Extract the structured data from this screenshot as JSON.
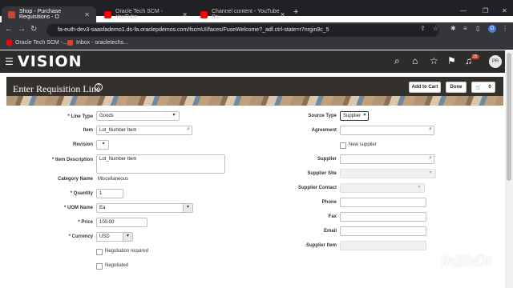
{
  "browser": {
    "tabs": [
      {
        "label": "Shop - Purchase Requisitions - O",
        "active": true
      },
      {
        "label": "Oracle Tech SCM - YouTube",
        "active": false
      },
      {
        "label": "Channel content - YouTube Stu",
        "active": false
      }
    ],
    "url": "fa-euth-dev3-saasfademo1.ds-fa.oraclepdemos.com/fscmUI/faces/FuseWelcome?_adf.ctrl-state=r7nrgin9c_5",
    "bookmarks": [
      "Oracle Tech SCM -...",
      "Inbox - oracletechs..."
    ]
  },
  "app": {
    "logo": "VISION",
    "notification_count": "25",
    "avatar_initials": "PR"
  },
  "page": {
    "title": "Enter Requisition Line",
    "add_to_cart": "Add to Cart",
    "done": "Done",
    "cart_count": "0"
  },
  "form_left": {
    "line_type_label": "Line Type",
    "line_type_value": "Goods",
    "item_label": "Item",
    "item_value": "Lot_Number Item",
    "revision_label": "Revision",
    "item_description_label": "Item Description",
    "item_description_value": "Lot_Number Item",
    "category_name_label": "Category Name",
    "category_name_value": "Miscellaneous",
    "quantity_label": "Quantity",
    "quantity_value": "1",
    "uom_name_label": "UOM Name",
    "uom_name_value": "Ea",
    "price_label": "Price",
    "price_value": "100.00",
    "currency_label": "Currency",
    "currency_value": "USD",
    "negotiation_required_label": "Negotiation required",
    "negotiated_label": "Negotiated"
  },
  "form_right": {
    "source_type_label": "Source Type",
    "source_type_value": "Supplier",
    "agreement_label": "Agreement",
    "new_supplier_label": "New supplier",
    "supplier_label": "Supplier",
    "supplier_site_label": "Supplier Site",
    "supplier_contact_label": "Supplier Contact",
    "phone_label": "Phone",
    "fax_label": "Fax",
    "email_label": "Email",
    "supplier_item_label": "Supplier Item"
  },
  "watermark": "InShOt",
  "colors": {
    "header_bg": "#2d2c2b",
    "banner_bg": "#34302c",
    "badge": "#c74634"
  }
}
